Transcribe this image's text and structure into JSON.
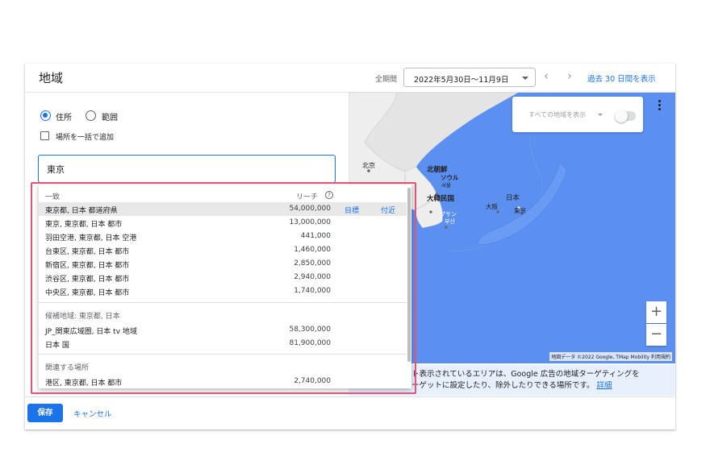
{
  "header": {
    "title": "地域",
    "period_label": "全期間",
    "date_range": "2022年5月30日～11月9日",
    "prev_label": "‹",
    "next_label": "›",
    "last30_link": "過去 30 日間を表示"
  },
  "location_panel": {
    "radio_address": "住所",
    "radio_radius": "範囲",
    "bulk_add_label": "場所を一括で追加",
    "search_value": "東京"
  },
  "dropdown": {
    "section_match": "一致",
    "reach_header": "リーチ",
    "help_glyph": "?",
    "match_rows": [
      {
        "name": "東京都, 日本 都道府県",
        "reach": "54,000,000",
        "target": "目標",
        "near": "付近"
      },
      {
        "name": "東京, 東京都, 日本 都市",
        "reach": "13,000,000"
      },
      {
        "name": "羽田空港, 東京都, 日本 空港",
        "reach": "441,000"
      },
      {
        "name": "台東区, 東京都, 日本 都市",
        "reach": "1,460,000"
      },
      {
        "name": "新宿区, 東京都, 日本 都市",
        "reach": "2,850,000"
      },
      {
        "name": "渋谷区, 東京都, 日本 都市",
        "reach": "2,940,000"
      },
      {
        "name": "中央区, 東京都, 日本 都市",
        "reach": "1,740,000"
      }
    ],
    "section_candidates": "候補地域: 東京都, 日本",
    "candidate_rows": [
      {
        "name": "JP_関東広域圏, 日本 tv 地域",
        "reach": "58,300,000"
      },
      {
        "name": "日本 国",
        "reach": "81,900,000"
      }
    ],
    "section_related": "関連する場所",
    "related_rows": [
      {
        "name": "港区, 東京都, 日本 都市",
        "reach": "2,740,000"
      }
    ]
  },
  "map": {
    "filter_label": "すべての地域を表示",
    "labels": {
      "beijing": "北京",
      "north_korea": "北朝鮮",
      "seoul": "ソウル",
      "seoul_kr": "서울",
      "south_korea": "大韓民国",
      "busan": "プサン",
      "busan_kr": "부산",
      "japan": "日本",
      "osaka": "大阪",
      "tokyo": "東京"
    },
    "zoom_in": "+",
    "zoom_out": "−",
    "attribution": "地図データ ©2022 Google, TMap Mobility   利用規約",
    "note_text": "ト表示されているエリアは、Google 広告の地域ターゲティングを\nーゲットに設定したり、除外したりできる場所です。",
    "note_link": "詳細"
  },
  "footer": {
    "save": "保存",
    "cancel": "キャンセル"
  },
  "colors": {
    "accent": "#1a73e8",
    "highlight_frame": "#e05577",
    "targeted_region": "#5b8ff0"
  }
}
